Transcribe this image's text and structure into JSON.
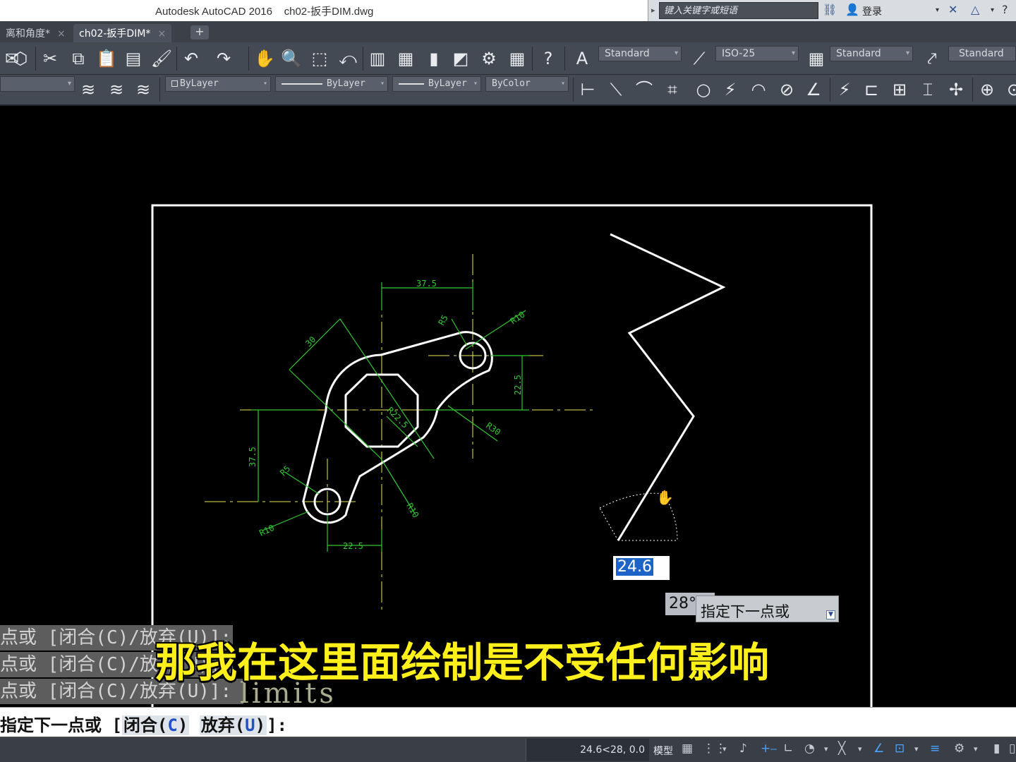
{
  "title": "Autodesk AutoCAD 2016    ch02-扳手DIM.dwg",
  "search": {
    "placeholder": "键入关键字或短语"
  },
  "login_label": "登录",
  "tabs": [
    {
      "label": "离和角度*",
      "close": "×"
    },
    {
      "label": "ch02-扳手DIM*",
      "close": "×"
    }
  ],
  "new_tab_label": "+",
  "styles": {
    "text_style": "Standard",
    "dim_style": "ISO-25",
    "table_style": "Standard",
    "multileader_style": "Standard"
  },
  "properties": {
    "color": "ByLayer",
    "linetype": "ByLayer",
    "lineweight": "ByLayer",
    "plotstyle": "ByColor"
  },
  "dimensions": {
    "d1": "37.5",
    "d2": "R5",
    "d3": "R10",
    "d4": "30",
    "d5": "22.5",
    "d6": "R22.5",
    "d7": "R30",
    "d8": "37.5",
    "d9": "R5",
    "d10": "R10",
    "d11": "R10",
    "d12": "22.5"
  },
  "dynamic_input": {
    "length_value": "24.6",
    "angle_value": "28°",
    "prompt": "指定下一点或"
  },
  "history": [
    "点或 [闭合(C)/放弃(U)]:",
    "点或 [闭合(C)/放弃(U)]:",
    "点或 [闭合(C)/放弃(U)]:"
  ],
  "history_overlap_text": "limits",
  "subtitle": "那我在这里面绘制是不受任何影响",
  "command_line": {
    "prefix": "指定下一点或 [",
    "opt1_pre": "闭合(",
    "opt1_key": "C",
    "opt1_post": ")",
    "opt2_pre": "放弃(",
    "opt2_key": "U",
    "opt2_post": ")",
    "suffix": "]:"
  },
  "status": {
    "coords": "24.6<28, 0.0",
    "model": "模型"
  },
  "colors": {
    "drawing_background": "#000000",
    "geometry": "#ffffff",
    "dimensions": "#33c733",
    "centerlines": "#e8e85a",
    "subtitle": "#ffef1a"
  }
}
